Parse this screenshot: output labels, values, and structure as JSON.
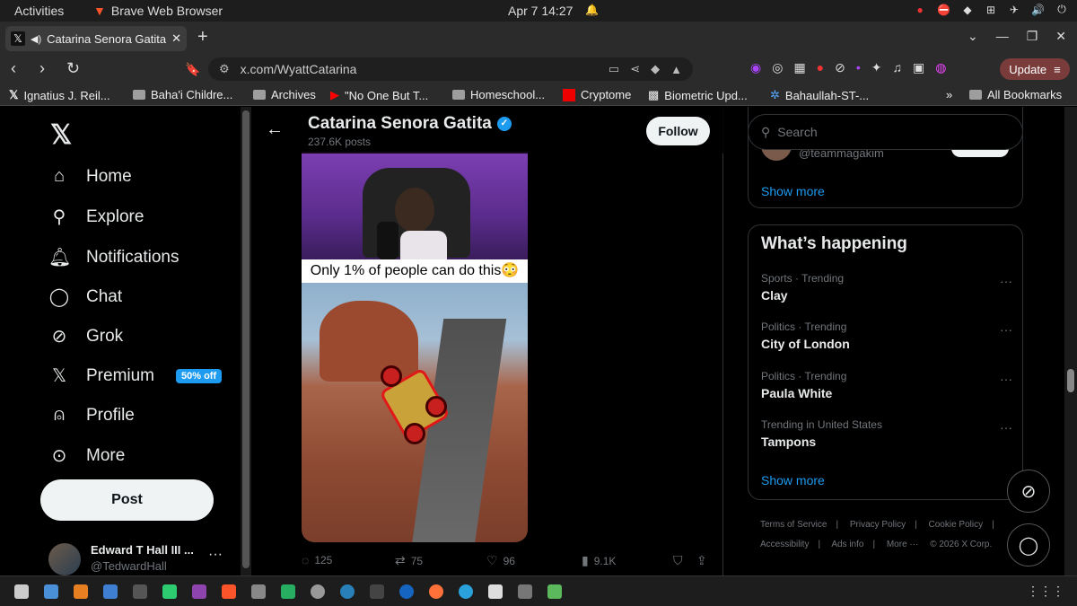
{
  "system": {
    "activities": "Activities",
    "app_name": "Brave Web Browser",
    "clock": "Apr 7  14:27"
  },
  "browser": {
    "tab_title": "Catarina Senora Gatita",
    "url": "x.com/WyattCatarina",
    "update_label": "Update"
  },
  "bookmarks": [
    {
      "label": "Ignatius J. Reil..."
    },
    {
      "label": "Baha'i Childre..."
    },
    {
      "label": "Archives"
    },
    {
      "label": "\"No One But T..."
    },
    {
      "label": "Homeschool..."
    },
    {
      "label": "Cryptome"
    },
    {
      "label": "Biometric Upd..."
    },
    {
      "label": "Bahaullah-ST-..."
    }
  ],
  "bookmarks_more": "»",
  "all_bookmarks": "All Bookmarks",
  "nav": {
    "items": [
      {
        "label": "Home",
        "icon": "home-icon"
      },
      {
        "label": "Explore",
        "icon": "search-icon"
      },
      {
        "label": "Notifications",
        "icon": "bell-icon"
      },
      {
        "label": "Chat",
        "icon": "chat-icon"
      },
      {
        "label": "Grok",
        "icon": "grok-icon"
      },
      {
        "label": "Premium",
        "icon": "x-icon"
      },
      {
        "label": "Profile",
        "icon": "person-icon"
      },
      {
        "label": "More",
        "icon": "more-circle-icon"
      }
    ],
    "premium_badge": "50% off",
    "post_label": "Post"
  },
  "account": {
    "name": "Edward T Hall III ...",
    "handle": "@TedwardHall"
  },
  "profile_header": {
    "name": "Catarina Senora Gatita",
    "posts": "237.6K posts",
    "follow_label": "Follow"
  },
  "tweet": {
    "caption": "Only 1% of people can do this😳",
    "replies": "125",
    "reposts": "75",
    "likes": "96",
    "views": "9.1K"
  },
  "sidebar": {
    "search_placeholder": "Search",
    "partial_handle": "@teammagakim",
    "show_more": "Show more",
    "trends_title": "What’s happening",
    "trends": [
      {
        "context": "Sports · Trending",
        "name": "Clay"
      },
      {
        "context": "Politics · Trending",
        "name": "City of London"
      },
      {
        "context": "Politics · Trending",
        "name": "Paula White"
      },
      {
        "context": "Trending in United States",
        "name": "Tampons"
      }
    ],
    "footer": {
      "terms": "Terms of Service",
      "privacy": "Privacy Policy",
      "cookie": "Cookie Policy",
      "accessibility": "Accessibility",
      "ads": "Ads info",
      "more": "More ···",
      "copyright": "© 2026 X Corp."
    }
  },
  "colors": {
    "accent": "#1d9bf0",
    "background": "#000000",
    "muted": "#71767b"
  }
}
